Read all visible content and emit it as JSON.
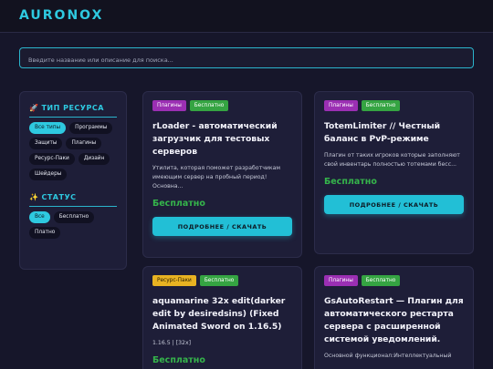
{
  "brand": "AURONOX",
  "search": {
    "placeholder": "Введите название или описание для поиска...",
    "value": ""
  },
  "filters": {
    "type_title": "ТИП РЕСУРСА",
    "type_icon": "rocket-icon",
    "types": [
      {
        "label": "Все типы",
        "active": true
      },
      {
        "label": "Программы",
        "active": false
      },
      {
        "label": "Защиты",
        "active": false
      },
      {
        "label": "Плагины",
        "active": false
      },
      {
        "label": "Ресурс-Паки",
        "active": false
      },
      {
        "label": "Дизайн",
        "active": false
      },
      {
        "label": "Шейдеры",
        "active": false
      }
    ],
    "status_title": "СТАТУС",
    "status_icon": "sparkles-icon",
    "statuses": [
      {
        "label": "Все",
        "active": true
      },
      {
        "label": "Бесплатно",
        "active": false
      },
      {
        "label": "Платно",
        "active": false
      }
    ]
  },
  "cards": [
    {
      "badges": [
        "Плагины",
        "Бесплатно"
      ],
      "title": "rLoader - автоматический загрузчик для тестовых серверов",
      "desc": "Утилита, которая поможет разработчикам имеющим сервер на пробный период! Основна...",
      "price": "Бесплатно",
      "button": "ПОДРОБНЕЕ / СКАЧАТЬ"
    },
    {
      "badges": [
        "Плагины",
        "Бесплатно"
      ],
      "title": "TotemLimiter // Честный баланс в PvP-режиме",
      "desc": "Плагин от таких игроков которые заполняют свой инвентарь полностью тотемами бесс...",
      "price": "Бесплатно",
      "button": "ПОДРОБНЕЕ / СКАЧАТЬ"
    },
    {
      "badges": [
        "Ресурс-Паки",
        "Бесплатно"
      ],
      "title": "aquamarine 32x edit(darker edit by desiredsins) (Fixed Animated Sword on 1.16.5)",
      "desc": "1.16.5 | [32x]",
      "price": "Бесплатно"
    },
    {
      "badges": [
        "Плагины",
        "Бесплатно"
      ],
      "title": "GsAutoRestart — Плагин для автоматического рестарта сервера с расширенной системой уведомлений.",
      "desc": "Основной функционал:Интеллектуальный"
    }
  ],
  "colors": {
    "accent": "#2ec9e0",
    "price": "#35b54b",
    "plugins": "#9b2fb3",
    "free": "#35a442",
    "packs": "#e8b322"
  }
}
